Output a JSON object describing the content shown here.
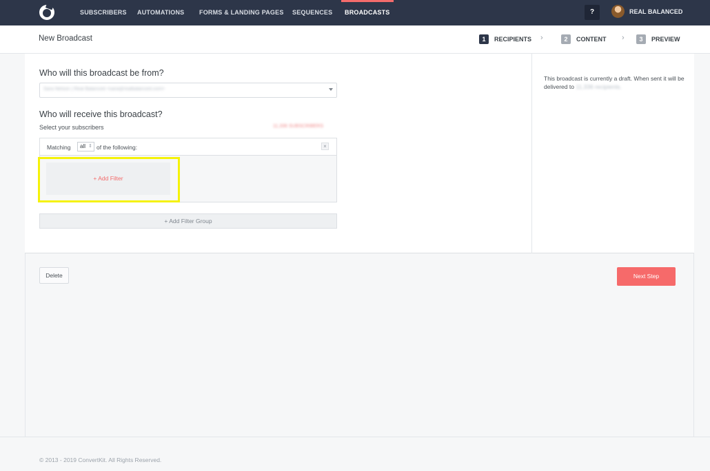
{
  "nav": {
    "items": [
      "SUBSCRIBERS",
      "AUTOMATIONS",
      "FORMS & LANDING PAGES",
      "SEQUENCES",
      "BROADCASTS"
    ],
    "active": "BROADCASTS",
    "help_label": "?",
    "account_name": "REAL BALANCED",
    "icons": {
      "logo": "convertkit-logo-icon",
      "avatar": "user-avatar"
    }
  },
  "header": {
    "title": "New Broadcast",
    "steps": [
      {
        "num": "1",
        "label": "RECIPIENTS",
        "active": true
      },
      {
        "num": "2",
        "label": "CONTENT",
        "active": false
      },
      {
        "num": "3",
        "label": "PREVIEW",
        "active": false
      }
    ],
    "separator": "›"
  },
  "form": {
    "from_question": "Who will this broadcast be from?",
    "from_value": "Sara Nelson | Real Balanced <sara@realbalanced.com>",
    "to_question": "Who will receive this broadcast?",
    "select_label": "Select your subscribers",
    "subscriber_count": "11,336 SUBSCRIBERS",
    "matching_prefix": "Matching",
    "matching_value": "all",
    "matching_suffix": "of the following:",
    "remove_label": "×",
    "add_filter_label": "+ Add Filter",
    "add_group_label": "+ Add Filter Group"
  },
  "sidebar": {
    "draft_note": "This broadcast is currently a draft. When sent it will be delivered to",
    "recipient_count": "11,336 recipients."
  },
  "actions": {
    "delete_label": "Delete",
    "next_label": "Next Step"
  },
  "footer": {
    "copyright": "© 2013 - 2019 ConvertKit. All Rights Reserved."
  },
  "colors": {
    "nav_bg": "#2d3649",
    "accent": "#f66a6a",
    "highlight": "#f5f209"
  }
}
